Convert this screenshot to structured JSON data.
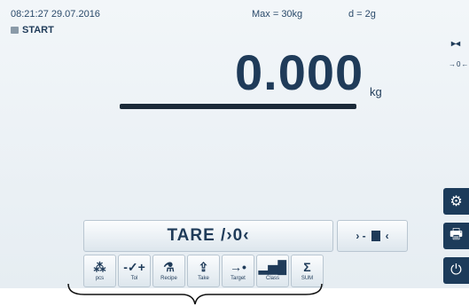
{
  "status": {
    "datetime": "08:21:27 29.07.2016",
    "max": "Max = 30kg",
    "division": "d = 2g"
  },
  "mode": {
    "label": "START"
  },
  "display": {
    "weight": "0.000",
    "unit": "kg"
  },
  "indicators": {
    "right_top": "▸◂",
    "right_zero": "→0←"
  },
  "buttons": {
    "tare": "TARE /›0‹",
    "zero": "›-  ‹"
  },
  "functions": [
    {
      "glyph": "⁂",
      "label": "pcs"
    },
    {
      "glyph": "-✓+",
      "label": "Tol"
    },
    {
      "glyph": "⚗",
      "label": "Recipe"
    },
    {
      "glyph": "⇪",
      "label": "Take"
    },
    {
      "glyph": "→•",
      "label": "Target"
    },
    {
      "glyph": "▂▅█",
      "label": "Class"
    },
    {
      "glyph": "Σ",
      "label": "SUM"
    }
  ],
  "side_icons": [
    "gear-icon",
    "printer-icon",
    "power-icon"
  ],
  "colors": {
    "accent": "#1c3b5a",
    "background": "#eef3f6",
    "text": "#1f3b59"
  }
}
